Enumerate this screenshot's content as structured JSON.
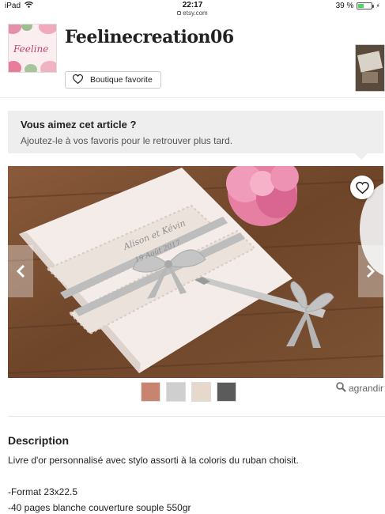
{
  "status_bar": {
    "device": "iPad",
    "time": "22:17",
    "url": "etsy.com",
    "battery": "39 %",
    "battery_level": 0.39
  },
  "shop": {
    "name": "Feelinecreation06",
    "logo_text": "Feeline",
    "favorite_button": "Boutique favorite"
  },
  "favorite_banner": {
    "title": "Vous aimez cet article ?",
    "subtitle": "Ajoutez-le à vos favoris pour le retrouver plus tard."
  },
  "photo": {
    "card_text_line1": "Alison et Kévin",
    "card_text_line2": "19 Août 2017"
  },
  "gallery": {
    "zoom_label": "agrandir",
    "thumb_colors": [
      "#c8846e",
      "#cfcfcf",
      "#e6d9cc",
      "#5b5b5b"
    ]
  },
  "description": {
    "heading": "Description",
    "lines": [
      "Livre d'or personnalisé avec stylo assorti à la coloris du ruban choisit.",
      "",
      "-Format 23x22.5",
      "-40 pages blanche couverture souple 550gr"
    ]
  },
  "icons": {
    "wifi": "wifi-icon",
    "heart": "heart-icon",
    "zoom": "magnifier-icon",
    "prev": "chevron-left-icon",
    "next": "chevron-right-icon"
  }
}
